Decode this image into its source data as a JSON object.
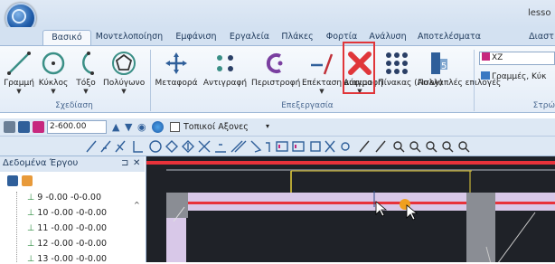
{
  "window": {
    "title": "lesso"
  },
  "tabs": [
    {
      "label": "Βασικό",
      "active": true
    },
    {
      "label": "Μοντελοποίηση"
    },
    {
      "label": "Εμφάνιση"
    },
    {
      "label": "Εργαλεία"
    },
    {
      "label": "Πλάκες"
    },
    {
      "label": "Φορτία"
    },
    {
      "label": "Ανάλυση"
    },
    {
      "label": "Αποτελέσματα"
    },
    {
      "label": "Διαστ"
    }
  ],
  "ribbon": {
    "group_draw": {
      "label": "Σχεδίαση",
      "buttons": [
        "Γραμμή",
        "Κύκλος",
        "Τόξο",
        "Πολύγωνο"
      ]
    },
    "group_edit": {
      "label": "Επεξεργασία",
      "buttons": [
        "Μεταφορά",
        "Αντιγραφή",
        "Περιστροφή",
        "Επέκταση κόψιμο",
        "Διαγραφή",
        "Πίνακας (Array)",
        "Πολλαπλές επιλογές"
      ]
    },
    "group_right": {
      "label": "Στρώ",
      "layer_combo": "XZ",
      "lines_label": "Γραμμές, Κύκ"
    }
  },
  "toolbar": {
    "elevation_value": "2-600.00",
    "coord_system": "Τοπικοί Αξονες"
  },
  "panel": {
    "title": "Δεδομένα Έργου",
    "pin_glyph": "⊐",
    "close_glyph": "✕",
    "items": [
      "9 -0.00 -0-0.00",
      "10 -0.00 -0-0.00",
      "11 -0.00 -0-0.00",
      "12 -0.00 -0-0.00",
      "13 -0.00 -0-0.00"
    ]
  },
  "colors": {
    "accent": "#1e395b",
    "highlight_box": "#e0363a",
    "canvas_bg": "#1f2228",
    "beam_fill": "#d8c8e8",
    "beam_red": "#e8323a"
  }
}
